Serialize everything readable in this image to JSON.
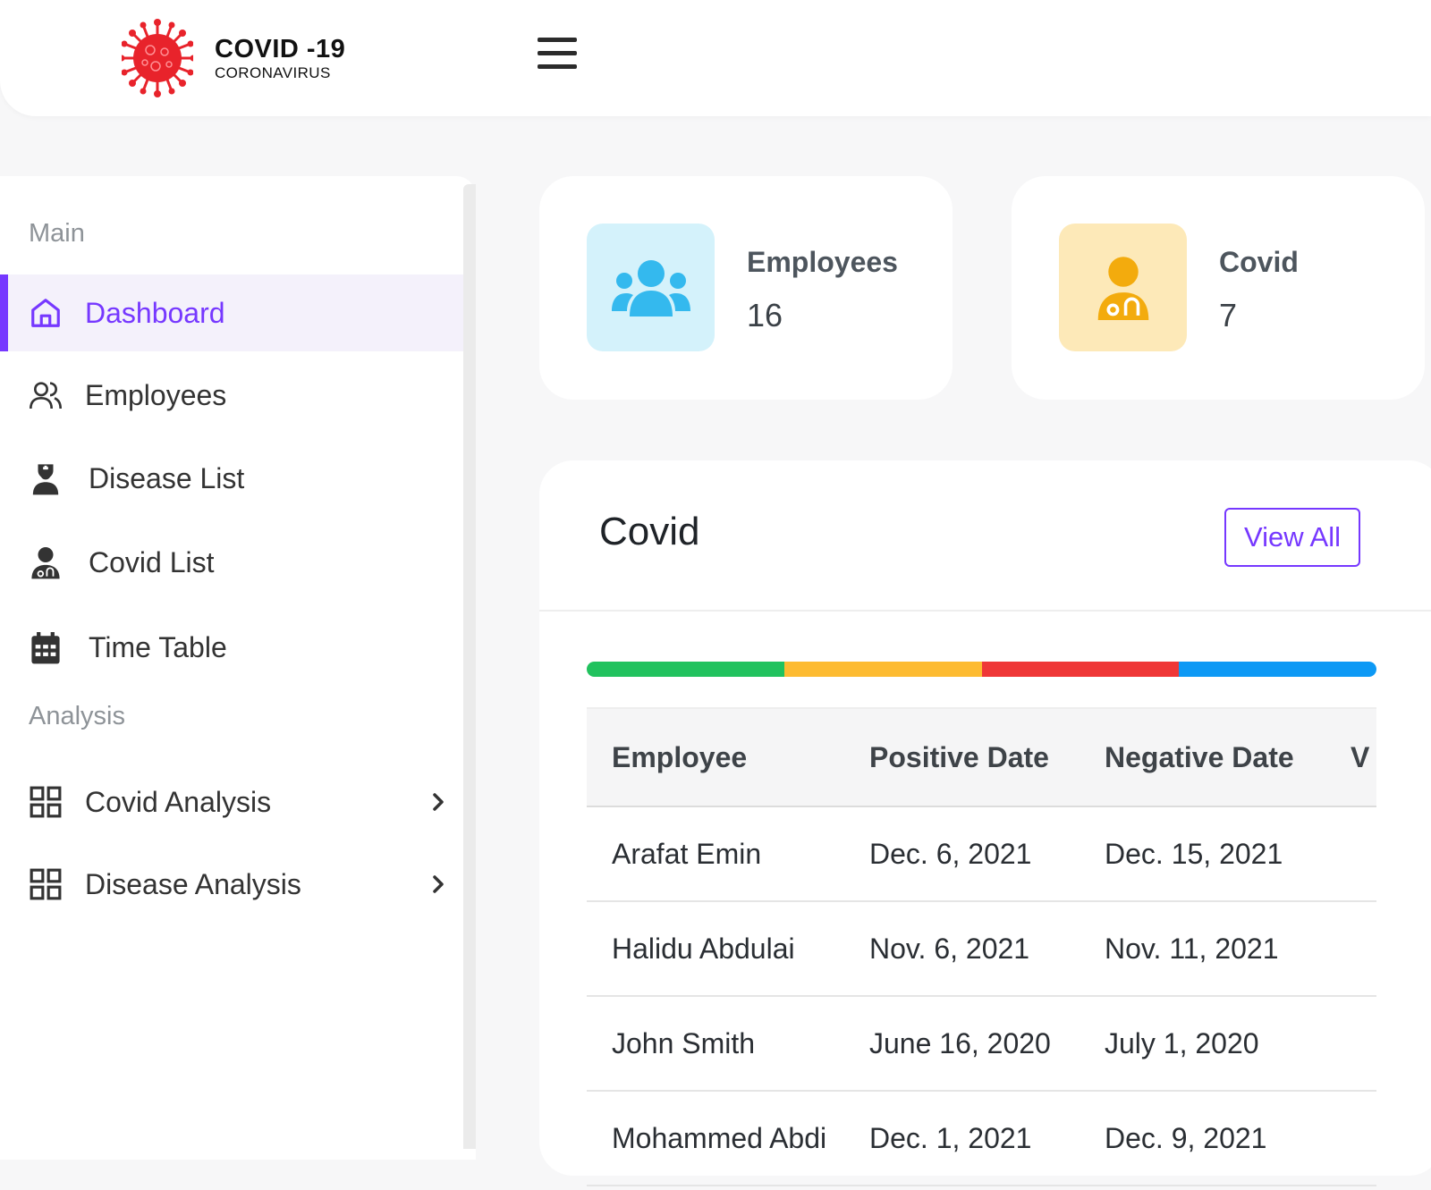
{
  "brand": {
    "title": "COVID -19",
    "subtitle": "CORONAVIRUS"
  },
  "sidebar": {
    "sections": [
      {
        "label": "Main"
      },
      {
        "label": "Analysis"
      }
    ],
    "items": [
      {
        "label": "Dashboard",
        "icon": "home-icon",
        "active": true
      },
      {
        "label": "Employees",
        "icon": "users-icon"
      },
      {
        "label": "Disease List",
        "icon": "nurse-icon"
      },
      {
        "label": "Covid List",
        "icon": "doctor-icon"
      },
      {
        "label": "Time Table",
        "icon": "calendar-icon"
      },
      {
        "label": "Covid Analysis",
        "icon": "grid-icon",
        "has_submenu": true
      },
      {
        "label": "Disease Analysis",
        "icon": "grid-icon",
        "has_submenu": true
      }
    ]
  },
  "stats": [
    {
      "title": "Employees",
      "value": "16",
      "icon": "group-icon",
      "bg": "#d4f2fb",
      "color": "#34b9ee"
    },
    {
      "title": "Covid",
      "value": "7",
      "icon": "doctor-icon",
      "bg": "#fde9b8",
      "color": "#f3ab0d"
    }
  ],
  "covid_card": {
    "title": "Covid",
    "view_all": "View All",
    "progress_colors": [
      "#21c25e",
      "#fdbb31",
      "#ef3737",
      "#0d99f5"
    ],
    "columns": [
      "Employee",
      "Positive Date",
      "Negative Date"
    ],
    "rows": [
      [
        "Arafat Emin",
        "Dec. 6, 2021",
        "Dec. 15, 2021"
      ],
      [
        "Halidu Abdulai",
        "Nov. 6, 2021",
        "Nov. 11, 2021"
      ],
      [
        "John Smith",
        "June 16, 2020",
        "July 1, 2020"
      ],
      [
        "Mohammed Abdi",
        "Dec. 1, 2021",
        "Dec. 9, 2021"
      ]
    ]
  }
}
